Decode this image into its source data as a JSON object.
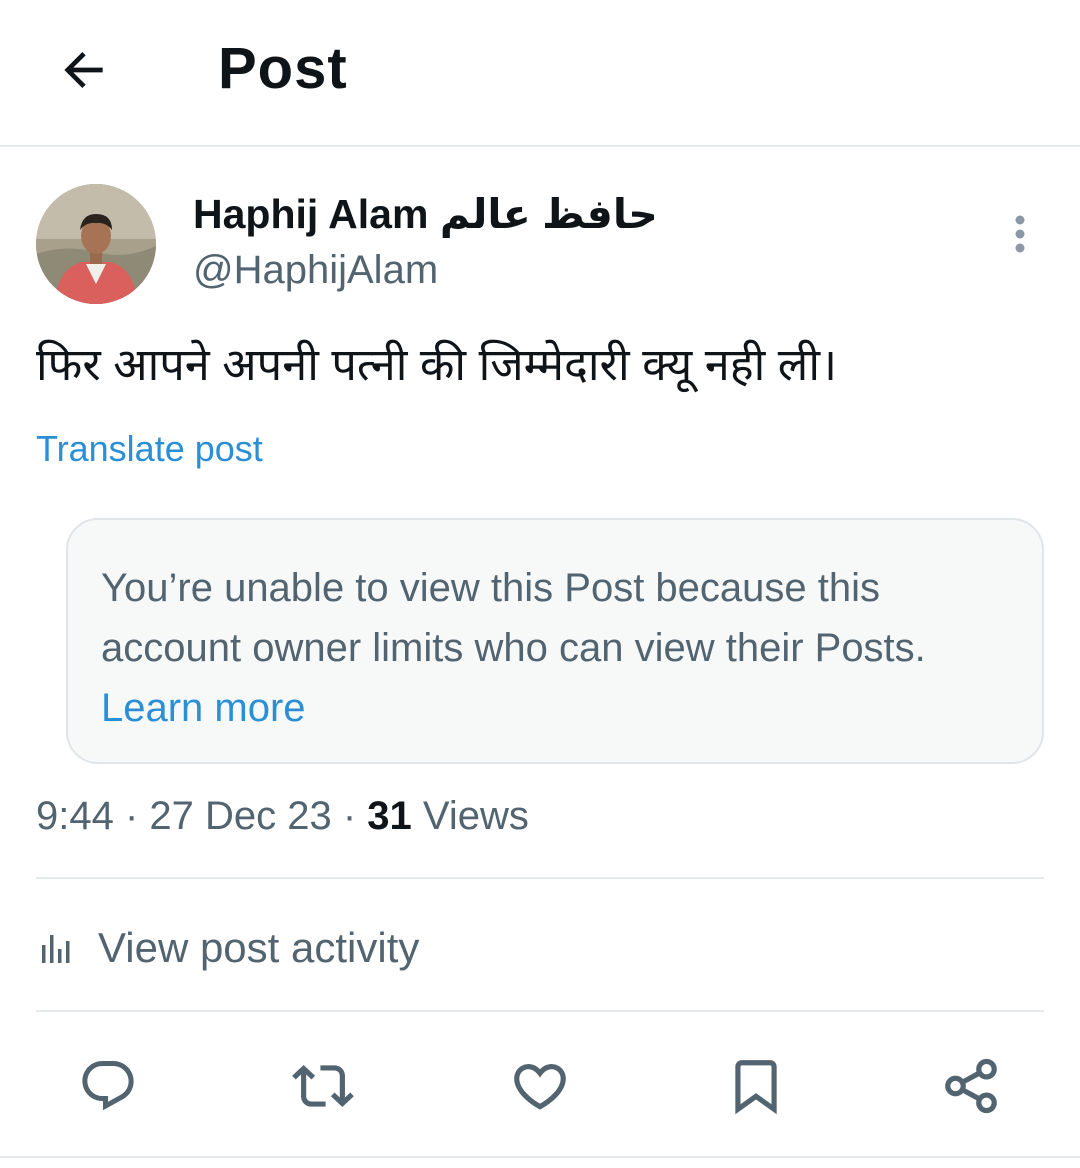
{
  "header": {
    "title": "Post",
    "back_icon": "arrow-left-icon"
  },
  "author": {
    "name": "Haphij Alam حافظ عالم",
    "handle": "@HaphijAlam",
    "more_icon": "more-vertical-icon"
  },
  "post": {
    "text": "फिर आपने अपनी पत्नी की जिम्मेदारी क्यू नही ली।",
    "translate_label": "Translate post"
  },
  "notice": {
    "text": "You’re unable to view this Post because this account owner limits who can view their Posts.",
    "link_label": "Learn more"
  },
  "meta": {
    "time": "9:44",
    "separator": " · ",
    "date": "27 Dec 23",
    "views_count": "31",
    "views_label": "Views"
  },
  "activity": {
    "label": "View post activity",
    "icon": "bar-chart-icon"
  },
  "actions": [
    {
      "icon": "reply-icon"
    },
    {
      "icon": "repost-icon"
    },
    {
      "icon": "like-icon"
    },
    {
      "icon": "bookmark-icon"
    },
    {
      "icon": "share-icon"
    }
  ],
  "colors": {
    "link": "#2b8fd6",
    "secondary_text": "#536471",
    "primary_text": "#0f1419",
    "divider": "#e6e9ec",
    "notice_bg": "#f7f9f9"
  }
}
